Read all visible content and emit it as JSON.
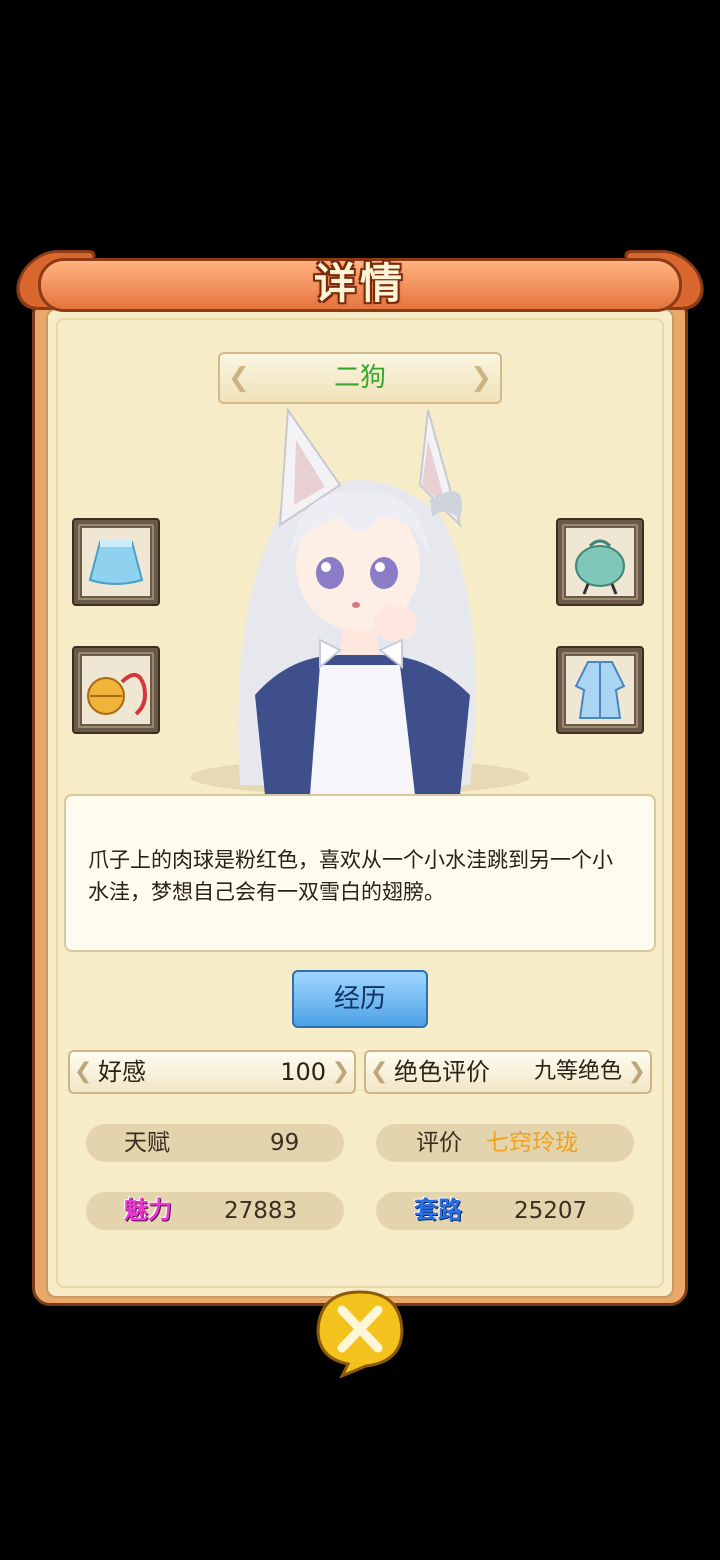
{
  "title": "详情",
  "character": {
    "name": "二狗"
  },
  "description": "爪子上的肉球是粉红色，喜欢从一个小水洼跳到另一个小水洼，梦想自己会有一双雪白的翅膀。",
  "buttons": {
    "experience": "经历"
  },
  "stats": {
    "favor": {
      "label": "好感",
      "value": "100"
    },
    "beauty_rating": {
      "label": "绝色评价",
      "value": "九等绝色"
    },
    "talent": {
      "label": "天赋",
      "value": "99"
    },
    "rating": {
      "label": "评价",
      "value": "七窍玲珑"
    },
    "charm": {
      "label": "魅力",
      "value": "27883"
    },
    "tactics": {
      "label": "套路",
      "value": "25207"
    }
  },
  "equipment": [
    {
      "name": "skirt-icon"
    },
    {
      "name": "pouch-icon"
    },
    {
      "name": "bell-icon"
    },
    {
      "name": "robe-icon"
    }
  ],
  "colors": {
    "name_green": "#36a82b",
    "rating_orange": "#f0a21a",
    "charm_pink": "#e83ad0",
    "tactics_blue": "#2a6ee8"
  }
}
